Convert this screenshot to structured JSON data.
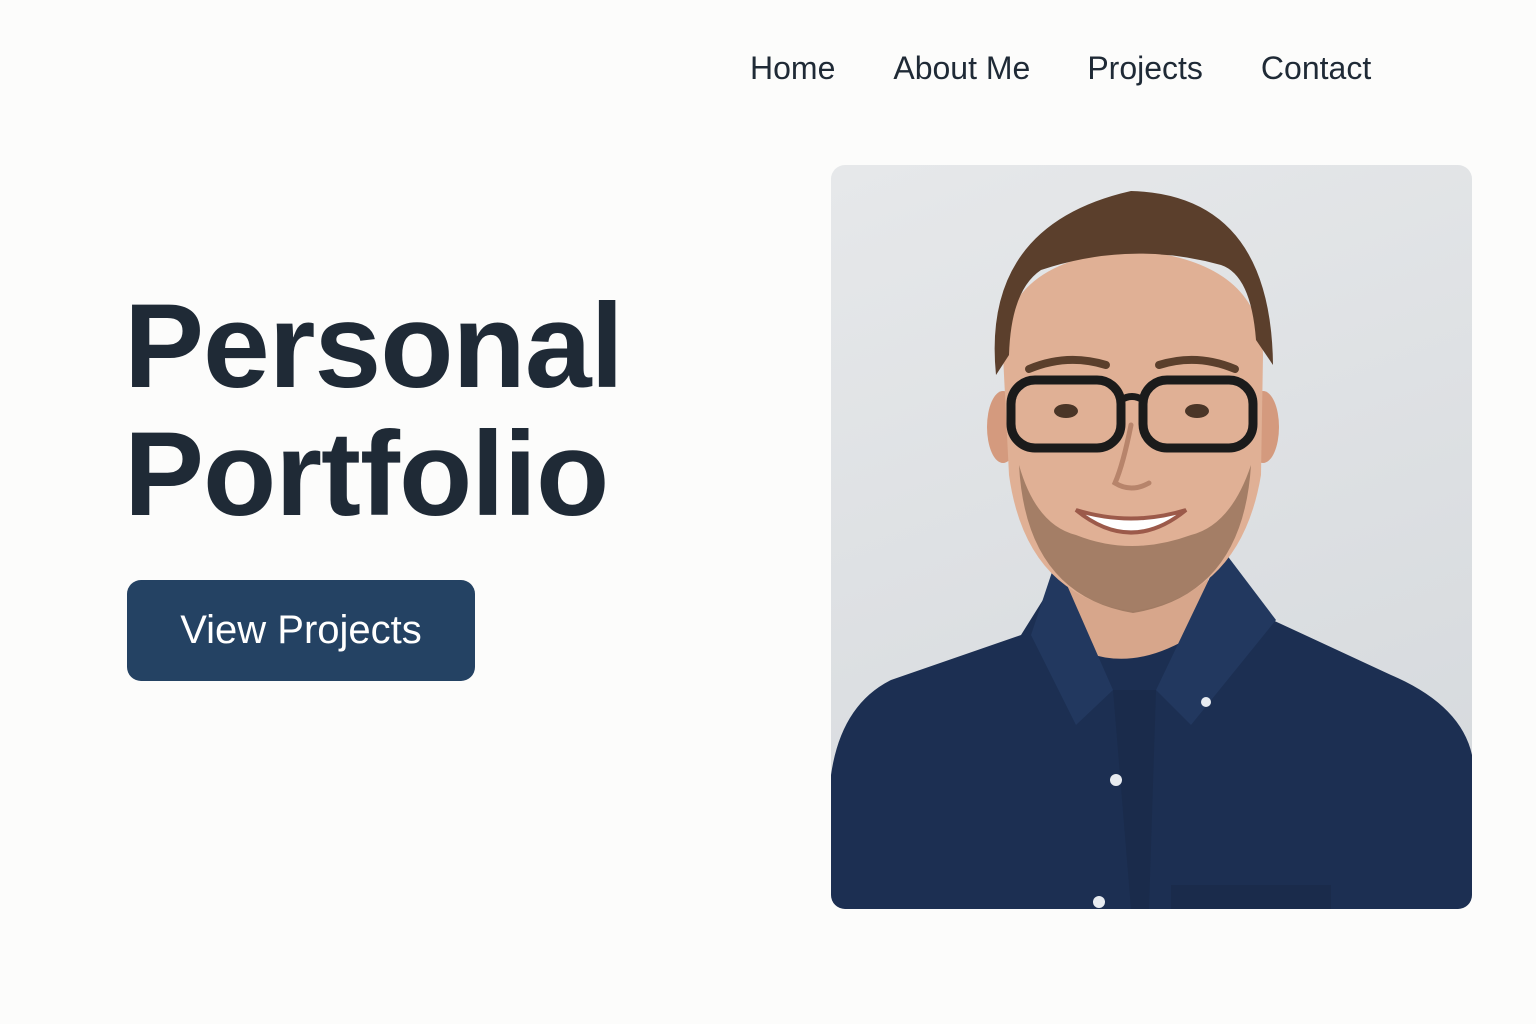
{
  "nav": {
    "items": [
      {
        "label": "Home"
      },
      {
        "label": "About Me"
      },
      {
        "label": "Projects"
      },
      {
        "label": "Contact"
      }
    ]
  },
  "hero": {
    "title_line1": "Personal",
    "title_line2": "Portfolio",
    "cta_label": "View Projects"
  },
  "profile_photo": {
    "alt": "Portrait of a smiling man with glasses in a navy shirt",
    "icon": "profile-photo"
  },
  "colors": {
    "background": "#fcfcfb",
    "text": "#1f2a36",
    "accent": "#244263",
    "cta_text": "#ffffff",
    "shirt": "#1c2f52"
  }
}
